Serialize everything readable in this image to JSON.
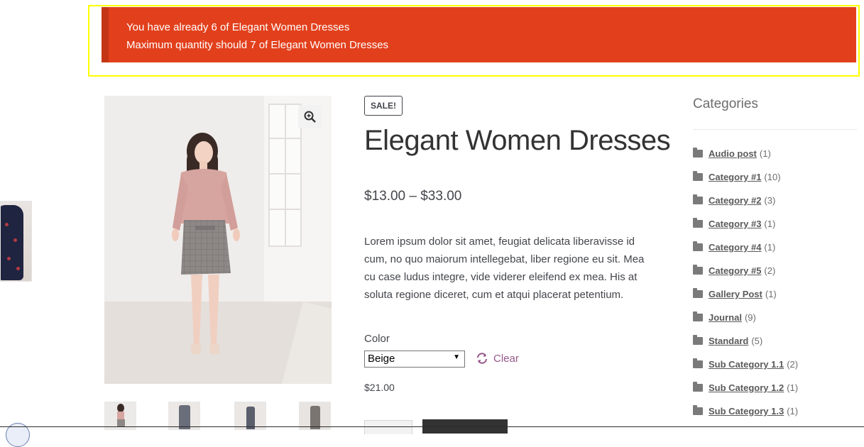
{
  "notice": {
    "line1": "You have already 6 of Elegant Women Dresses",
    "line2": "Maximum quantity should 7 of Elegant Women Dresses",
    "color": "#e2401c"
  },
  "product": {
    "sale_badge": "SALE!",
    "title": "Elegant Women Dresses",
    "price_range": "$13.00 – $33.00",
    "description": "Lorem ipsum dolor sit amet, feugiat delicata liberavisse id cum, no quo maiorum intellegebat, liber regione eu sit. Mea cu case ludus integre, vide viderer eleifend ex mea. His at soluta regione diceret, cum et atqui placerat petentium.",
    "color_label": "Color",
    "color_selected": "Beige",
    "clear_label": "Clear",
    "variation_price": "$21.00",
    "zoom_icon": "magnifier-plus-icon"
  },
  "sidebar": {
    "title": "Categories",
    "items": [
      {
        "name": "Audio post",
        "count": "(1)"
      },
      {
        "name": "Category #1",
        "count": "(10)"
      },
      {
        "name": "Category #2",
        "count": "(3)"
      },
      {
        "name": "Category #3",
        "count": "(1)"
      },
      {
        "name": "Category #4",
        "count": "(1)"
      },
      {
        "name": "Category #5",
        "count": "(2)"
      },
      {
        "name": "Gallery Post",
        "count": "(1)"
      },
      {
        "name": "Journal",
        "count": "(9)"
      },
      {
        "name": "Standard",
        "count": "(5)"
      },
      {
        "name": "Sub Category 1.1",
        "count": "(2)"
      },
      {
        "name": "Sub Category 1.2",
        "count": "(1)"
      },
      {
        "name": "Sub Category 1.3",
        "count": "(1)"
      }
    ]
  },
  "colors": {
    "accent_link": "#96588a",
    "text": "#43454b",
    "highlight_outline": "#ffff00"
  }
}
